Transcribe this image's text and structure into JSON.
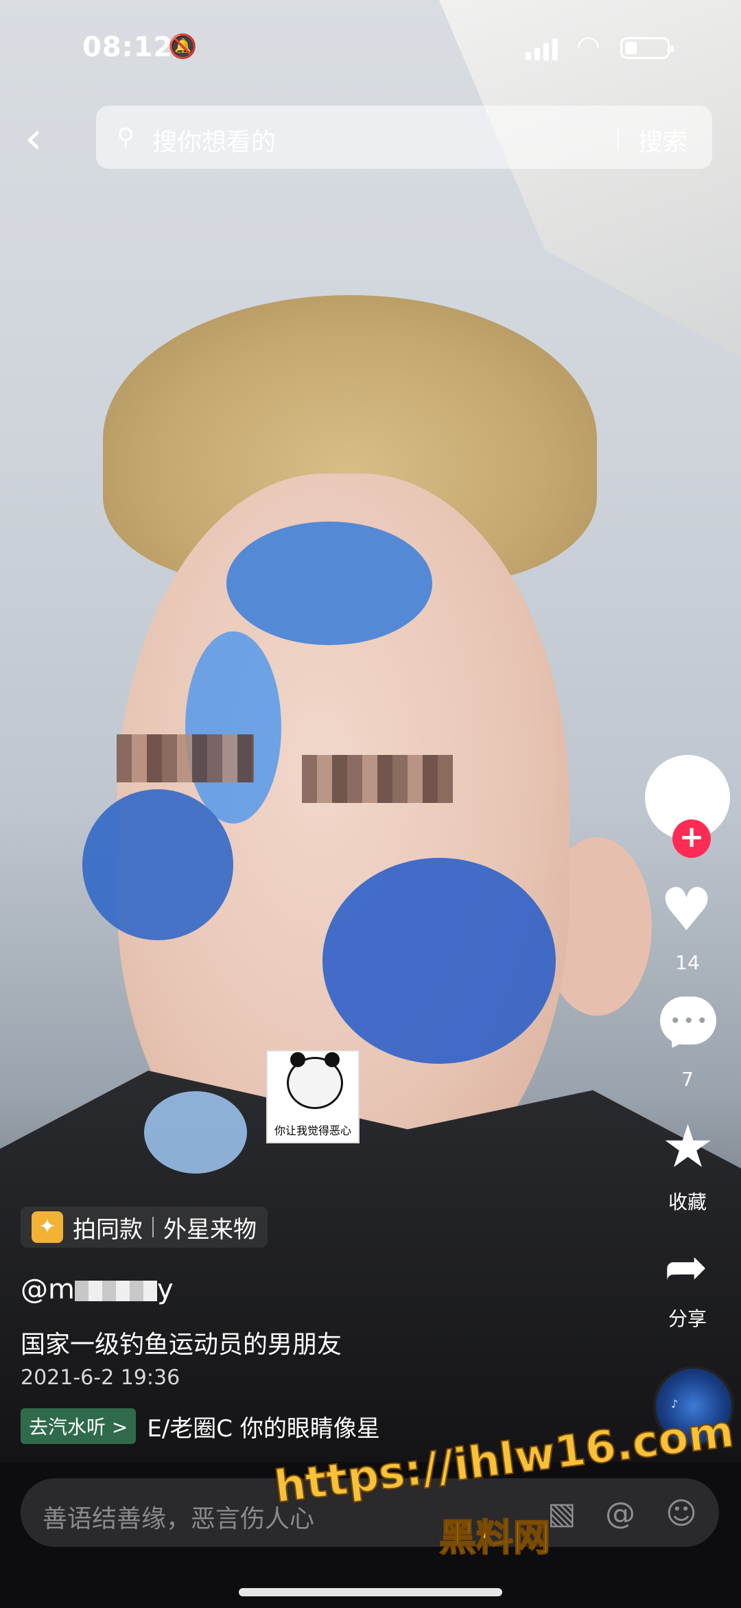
{
  "status_bar": {
    "time": "08:12",
    "mute_icon": "bell-slash-icon",
    "battery_fraction": 0.3
  },
  "search": {
    "back_icon": "‹",
    "placeholder": "搜你想看的",
    "button": "搜索"
  },
  "rail": {
    "follow_symbol": "+",
    "likes": "14",
    "comments": "7",
    "favorite_label": "收藏",
    "share_label": "分享"
  },
  "video": {
    "sticker_caption": "你让我觉得恶心",
    "effect": {
      "label": "拍同款",
      "name": "外星来物"
    },
    "author_prefix": "@m",
    "author_suffix": "y",
    "caption": "国家一级钓鱼运动员的男朋友",
    "date": "2021-6-2 19:36",
    "music_tag": "去汽水听 >",
    "music_text": "E/老圈C   你的眼睛像星"
  },
  "bottom": {
    "comment_placeholder": "善语结善缘，恶言伤人心",
    "icons": [
      "image-icon",
      "at-icon",
      "emoji-icon"
    ]
  },
  "watermark": {
    "url": "https://ihlw16.com",
    "site": "黑料网"
  },
  "colors": {
    "accent_red": "#fe2c55",
    "watermark": "#f7c23a",
    "effect_icon": "#f2b233"
  }
}
